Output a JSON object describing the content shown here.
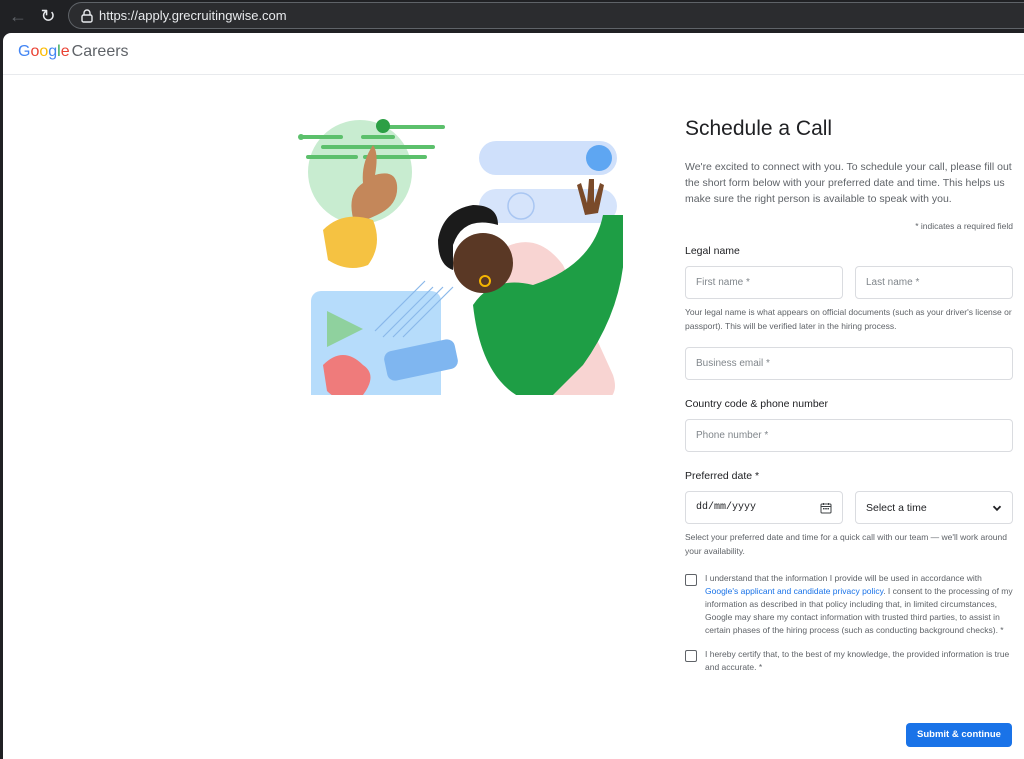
{
  "browser": {
    "url": "https://apply.grecruitingwise.com",
    "back_glyph": "←",
    "reload_glyph": "↻"
  },
  "header": {
    "logo_letters": [
      "G",
      "o",
      "o",
      "g",
      "l",
      "e"
    ],
    "logo_suffix": "Careers"
  },
  "form": {
    "title": "Schedule a Call",
    "intro": "We're excited to connect with you. To schedule your call, please fill out the short form below with your preferred date and time. This helps us make sure the right person is available to speak with you.",
    "required_note": "* indicates a required field",
    "legal_name_label": "Legal name",
    "first_name_placeholder": "First name *",
    "last_name_placeholder": "Last name *",
    "legal_name_help": "Your legal name is what appears on official documents (such as your driver's license or passport). This will be verified later in the hiring process.",
    "business_email_placeholder": "Business email *",
    "phone_label": "Country code & phone number",
    "phone_placeholder": "Phone number *",
    "date_label": "Preferred date *",
    "date_placeholder": "dd/mm/yyyy",
    "time_select_value": "Select a time",
    "date_help": "Select your preferred date and time for a quick call with our team — we'll work around your availability.",
    "consent_1_before": "I understand that the information I provide will be used in accordance with ",
    "consent_1_link": "Google's applicant and candidate privacy policy",
    "consent_1_after": ". I consent to the processing of my information as described in that policy including that, in limited circumstances, Google may share my contact information with trusted third parties, to assist in certain phases of the hiring process (such as conducting background checks). *",
    "consent_2": "I hereby certify that, to the best of my knowledge, the provided information is true and accurate. *",
    "submit_label": "Submit & continue"
  },
  "colors": {
    "accent": "#1a73e8",
    "brand_blue": "#4285f4",
    "brand_red": "#ea4335",
    "brand_yellow": "#fbbc05",
    "brand_green": "#34a853"
  },
  "icons": {
    "lock": "lock-icon",
    "calendar": "calendar-icon",
    "dropdown": "chevron-down-icon"
  }
}
